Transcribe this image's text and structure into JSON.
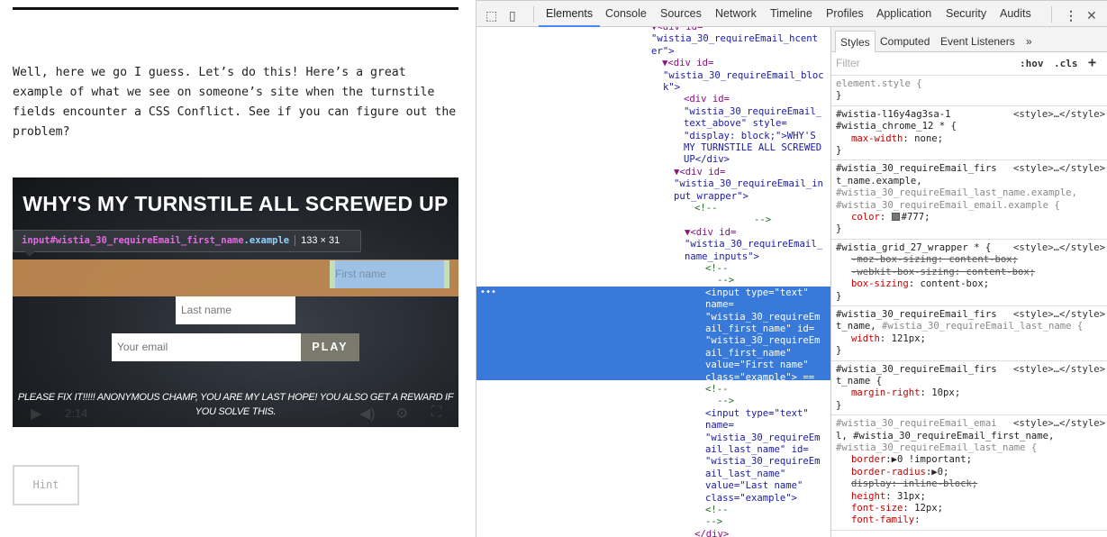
{
  "page": {
    "intro": "Well, here we go I guess. Let’s do this! Here’s a great example of what we see on someone’s site when the turnstile fields encounter a CSS Conflict. See if you can figure out the problem?",
    "video": {
      "title": "WHY'S MY TURNSTILE ALL SCREWED UP",
      "first_name": "First name",
      "last_name": "Last name",
      "email_placeholder": "Your email",
      "play": "PLAY",
      "footer": "PLEASE FIX IT!!!!! ANONYMOUS CHAMP, YOU ARE MY LAST HOPE! YOU ALSO GET A REWARD IF YOU SOLVE THIS.",
      "time": "2:14"
    },
    "tooltip": {
      "tag": "input",
      "id": "#wistia_30_requireEmail_first_name",
      "cls": ".example",
      "size": "133 × 31"
    },
    "hint": "Hint"
  },
  "devtools": {
    "tabs": [
      "Elements",
      "Console",
      "Sources",
      "Network",
      "Timeline",
      "Profiles",
      "Application",
      "Security",
      "Audits"
    ],
    "dom_lines": [
      "▼<div id=",
      "\"wistia_30_requireEmail_hcent",
      "er\">",
      "▼<div id=",
      "\"wistia_30_requireEmail_bloc",
      "k\">",
      "<div id=",
      "\"wistia_30_requireEmail_",
      "text_above\" style=",
      "\"display: block;\">WHY'S",
      "MY TURNSTILE ALL SCREWED",
      "UP</div>",
      "▼<div id=",
      "\"wistia_30_requireEmail_in",
      "put_wrapper\">",
      "<!--",
      "-->",
      "▼<div id=",
      "\"wistia_30_requireEmail_",
      "name_inputs\">",
      "<!--",
      "-->",
      "<input type=\"text\"",
      "name=",
      "\"wistia_30_requireEm",
      "ail_first_name\" id=",
      "\"wistia_30_requireEm",
      "ail_first_name\"",
      "value=\"First name\"",
      "class=\"example\"> ==",
      "<!--",
      "-->",
      "<input type=\"text\"",
      "name=",
      "\"wistia_30_requireEm",
      "ail_last_name\" id=",
      "\"wistia_30_requireEm",
      "ail_last_name\"",
      "value=\"Last name\"",
      "class=\"example\">",
      "<!--",
      "-->",
      "</div>"
    ],
    "styles": {
      "tabs": [
        "Styles",
        "Computed",
        "Event Listeners",
        "»"
      ],
      "filter_placeholder": "Filter",
      "hov": ":hov",
      "cls": ".cls",
      "add": "+",
      "src": "<style>…</style>",
      "rules": {
        "r0": {
          "sel": "element.style {",
          "close": "}"
        },
        "r1": {
          "sel1": "#wistia-l16y4ag3sa-1",
          "sel2": "#wistia_chrome_12 * {",
          "p1n": "max-width",
          "p1v": ": none;"
        },
        "r2": {
          "sel1": "#wistia_30_requireEmail_firs",
          "sel2": "t_name.example,",
          "sel3": "#wistia_30_requireEmail_last_name.example,",
          "sel4": "#wistia_30_requireEmail_email.example {",
          "p1n": "color",
          "p1v": "#777;"
        },
        "r3": {
          "sel1": "#wistia_grid_27_wrapper * {",
          "p1": "-moz-box-sizing: content-box;",
          "p2": "-webkit-box-sizing: content-box;",
          "p3n": "box-sizing",
          "p3v": ": content-box;"
        },
        "r4": {
          "sel1": "#wistia_30_requireEmail_firs",
          "sel2": "t_name,",
          "sel3": " #wistia_30_requireEmail_last_name {",
          "p1n": "width",
          "p1v": ": 121px;"
        },
        "r5": {
          "sel1": "#wistia_30_requireEmail_firs",
          "sel2": "t_name {",
          "p1n": "margin-right",
          "p1v": ": 10px;"
        },
        "r6": {
          "sel1": "#wistia_30_requireEmail_emai",
          "sel2": "l, #wistia_30_requireEmail_first_name,",
          "sel3": "#wistia_30_requireEmail_last_name {",
          "p1n": "border",
          "p1v": ":▶0 !important;",
          "p2n": "border-radius",
          "p2v": ":▶0;",
          "p3": "display: inline-block;",
          "p4n": "height",
          "p4v": ": 31px;",
          "p5n": "font-size",
          "p5v": ": 12px;",
          "p6n": "font-family",
          "p6v": ":"
        }
      }
    }
  }
}
